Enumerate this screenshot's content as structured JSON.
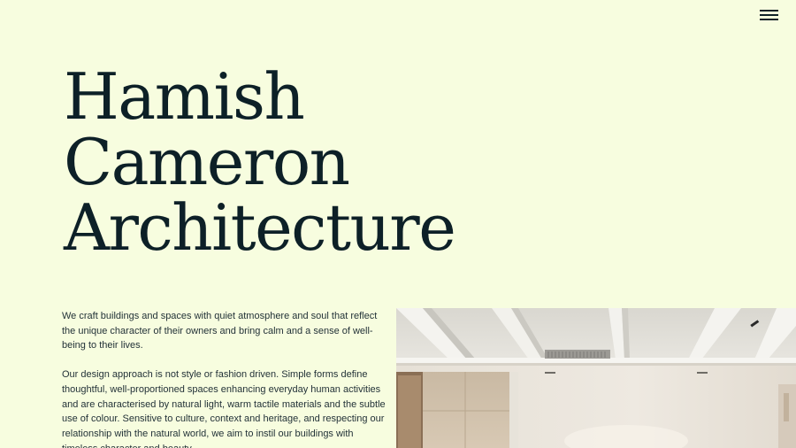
{
  "header": {
    "menu_icon": "hamburger-menu-icon"
  },
  "hero": {
    "title_lines": [
      "Hamish",
      "Cameron",
      "Architecture"
    ]
  },
  "intro": {
    "paragraph_1": "We craft buildings and spaces with quiet atmosphere and soul that reflect the unique character of their owners and bring calm and a sense of well-being to their lives.",
    "paragraph_2": "Our design approach is not style or fashion driven. Simple forms define thoughtful, well-proportioned spaces enhancing everyday human activities and are characterised by natural light, warm tactile materials and the subtle use of colour. Sensitive to culture, context and heritage, and respecting our relationship with the natural world, we aim to instil our buildings with timeless character and beauty."
  },
  "colors": {
    "background": "#f7fddf",
    "text": "#0f2228"
  }
}
